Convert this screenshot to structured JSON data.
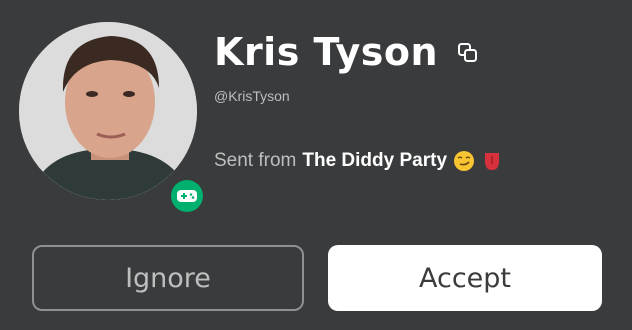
{
  "user": {
    "display_name": "Kris Tyson",
    "username": "@KrisTyson",
    "status": "in-game"
  },
  "request": {
    "sent_from_prefix": "Sent from",
    "experience_name": "The Diddy Party",
    "emojis": [
      "smirk-face-emoji",
      "tongue-emoji"
    ]
  },
  "actions": {
    "ignore_label": "Ignore",
    "accept_label": "Accept"
  },
  "colors": {
    "background": "#393b3d",
    "status_green": "#00b06f",
    "primary_text": "#ffffff",
    "secondary_text": "#bdbebe"
  }
}
